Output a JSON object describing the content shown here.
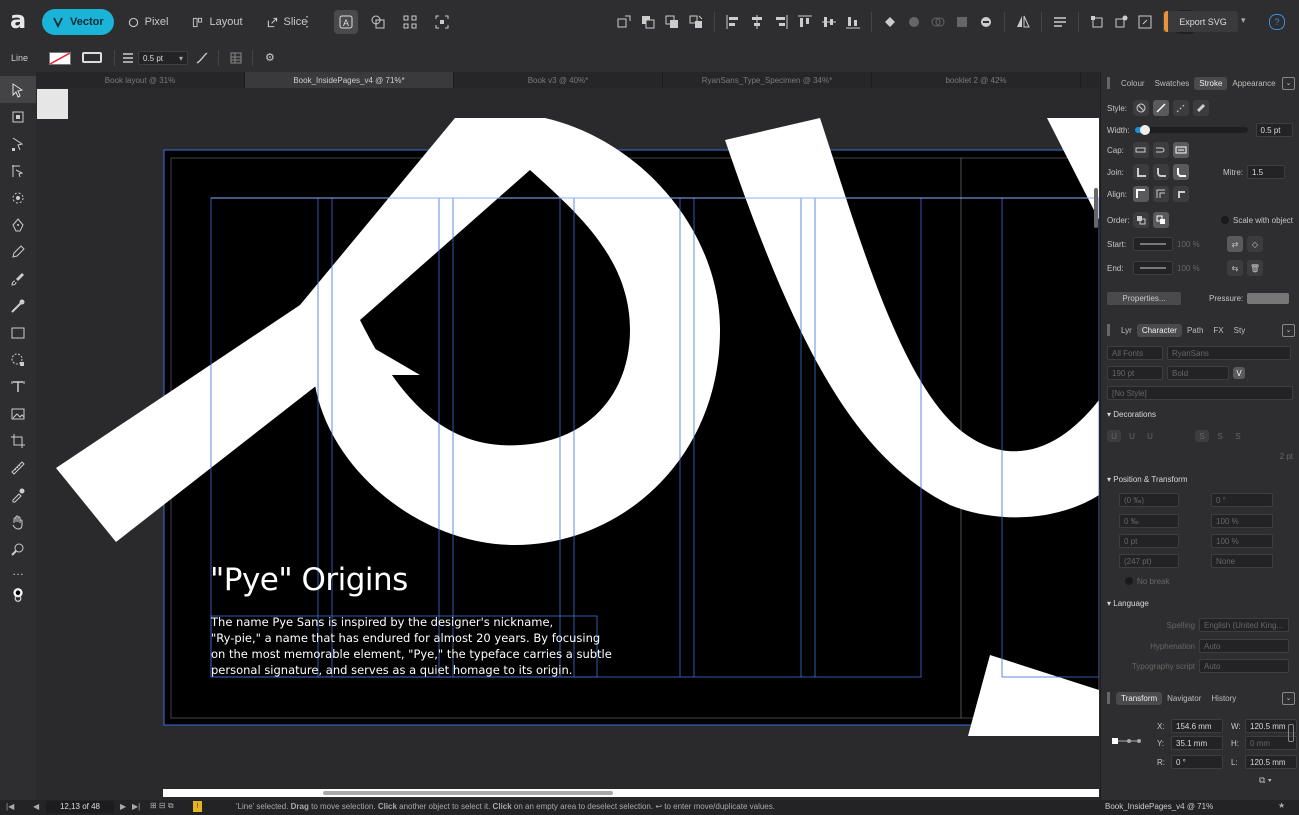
{
  "app": {
    "logo_letter": "a"
  },
  "personas": [
    {
      "label": "Vector",
      "active": true
    },
    {
      "label": "Pixel",
      "active": false
    },
    {
      "label": "Layout",
      "active": false
    },
    {
      "label": "Slice",
      "active": false
    }
  ],
  "export_button": "Export SVG",
  "help_icon": "?",
  "context": {
    "selection_type": "Line",
    "stroke_width": "0.5 pt"
  },
  "tabs": [
    {
      "label": "Book layout @ 31%",
      "active": false
    },
    {
      "label": "Book_InsidePages_v4 @ 71%*",
      "active": true
    },
    {
      "label": "Book v3 @ 40%*",
      "active": false
    },
    {
      "label": "RyanSans_Type_Specimen @ 34%*",
      "active": false
    },
    {
      "label": "booklet 2 @ 42%",
      "active": false
    }
  ],
  "document": {
    "heading": "\"Pye\" Origins",
    "body_lines": [
      "The name Pye Sans is inspired by the designer's nickname,",
      "\"Ry-pie,\" a name that has endured for almost 20 years. By focusing",
      "on the most memorable element, \"Pye,\" the typeface carries a subtle",
      "personal signature, and serves as a quiet homage to its origin."
    ]
  },
  "stroke_panel": {
    "tabs": [
      "Colour",
      "Swatches",
      "Stroke",
      "Appearance"
    ],
    "active_tab": "Stroke",
    "style_label": "Style:",
    "width_label": "Width:",
    "width_value": "0.5 pt",
    "width_fraction": 0.07,
    "cap_label": "Cap:",
    "join_label": "Join:",
    "mitre_label": "Mitre:",
    "mitre_value": "1.5",
    "align_label": "Align:",
    "order_label": "Order:",
    "scale_with_object": "Scale with object",
    "start_label": "Start:",
    "end_label": "End:",
    "start_pct": "100 %",
    "end_pct": "100 %",
    "properties_button": "Properties...",
    "pressure_label": "Pressure:"
  },
  "character_panel": {
    "tabs": [
      "Lyr",
      "Character",
      "Path",
      "FX",
      "Sty"
    ],
    "active_tab": "Character",
    "font_collection": "All Fonts",
    "font_family": "RyanSans",
    "font_size": "190 pt",
    "font_weight": "Bold",
    "style": "[No Style]",
    "decorations_title": "Decorations",
    "decoration_value": "2 pt",
    "position_title": "Position & Transform",
    "pt_values": [
      "(0 ‰)",
      "0 °",
      "0 ‰",
      "100 %",
      "0 pt",
      "100 %",
      "(247 pt)",
      "None"
    ],
    "no_break": "No break",
    "language_title": "Language",
    "spelling_label": "Spelling",
    "spelling_value": "English (United King...",
    "hyphenation_label": "Hyphenation",
    "hyphenation_value": "Auto",
    "typography_label": "Typography script",
    "typography_value": "Auto"
  },
  "transform_panel": {
    "tabs": [
      "Transform",
      "Navigator",
      "History"
    ],
    "active_tab": "Transform",
    "x_label": "X:",
    "x_value": "154.6 mm",
    "y_label": "Y:",
    "y_value": "35.1 mm",
    "w_label": "W:",
    "w_value": "120.5 mm",
    "h_label": "H:",
    "h_value": "0 mm",
    "r_label": "R:",
    "r_value": "0 °",
    "l_label": "L:",
    "l_value": "120.5 mm"
  },
  "status": {
    "page_indicator": "12,13 of 48",
    "hint_prefix": "'Line' selected. ",
    "hint_b1": "Drag",
    "hint_t1": " to move selection. ",
    "hint_b2": "Click",
    "hint_t2": " another object to select it. ",
    "hint_b3": "Click",
    "hint_t3": " on an empty area to deselect selection. ↩ to enter move/duplicate values.",
    "document_name": "Book_InsidePages_v4 @ 71%"
  },
  "colors": {
    "accent": "#1ab4d8",
    "export": "#e8923a",
    "guide": "#3b6fd6",
    "artboard": "#000000"
  }
}
